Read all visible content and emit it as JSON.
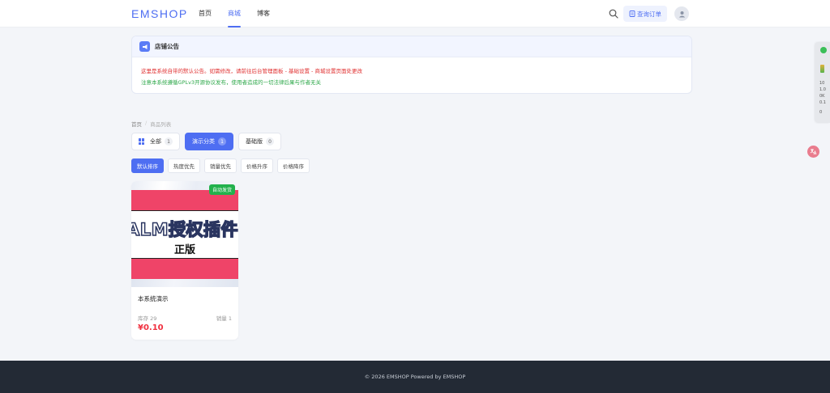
{
  "header": {
    "logo": "EMSHOP",
    "nav": [
      "首页",
      "商城",
      "博客"
    ],
    "active_nav": 1,
    "order_button": "查询订单"
  },
  "notice": {
    "title": "店铺公告",
    "line1": "这里是系统自带的默认公告。如需修改，请前往后台管理面板 - 基础设置 - 商城设置页面处更改",
    "line2": "注意本系统遵循GPLv3开源协议发布，使用者造成的一切法律后果与作者无关"
  },
  "breadcrumb": {
    "home": "首页",
    "separator": "/",
    "current": "商品列表"
  },
  "categories": [
    {
      "label": "全部",
      "count": "1",
      "active": false
    },
    {
      "label": "演示分类",
      "count": "1",
      "active": true
    },
    {
      "label": "基础版",
      "count": "0",
      "active": false
    }
  ],
  "sort": [
    "默认排序",
    "热度优先",
    "销量优先",
    "价格升序",
    "价格降序"
  ],
  "product": {
    "tag": "自动发货",
    "image_text1": "ALM授权插件",
    "image_text2": "正版",
    "name": "本系统演示",
    "stock": "库存 29",
    "sales": "销量 1",
    "price": "¥0.10"
  },
  "footer": {
    "text": "© 2026 EMSHOP  Powered by EMSHOP"
  },
  "side_panel": {
    "values": [
      "10",
      "1.0",
      "0K",
      "0.1",
      "0"
    ]
  },
  "colors": {
    "accent": "#4e6ef2",
    "price": "#f0303f",
    "notice_red": "#e03030",
    "notice_green": "#2ea84a",
    "tag_green": "#22b14c",
    "footer_bg": "#232a35"
  }
}
